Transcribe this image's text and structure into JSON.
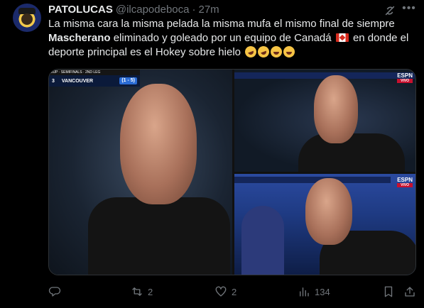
{
  "author": {
    "display_name": "PATOLUCAS",
    "handle": "@ilcapodeboca",
    "separator": "·",
    "time": "27m"
  },
  "tweet": {
    "line1": "La misma cara la misma pelada la misma mufa el mismo final de siempre",
    "bold_name": "Mascherano",
    "line2_after": " eliminado y goleado por un equipo de Canadá ",
    "line2_tail": " en donde el",
    "line3": "deporte principal es el Hokey sobre hielo "
  },
  "media": {
    "scoreboard": {
      "stage": "JUP · SEMIFINALS · 2ND LEG",
      "home_score": "3",
      "away_team": "VANCOUVER",
      "aggregate": "(1 - 5)"
    },
    "espn_logo": "ESPN",
    "espn_live": "VIVO"
  },
  "actions": {
    "replies": "",
    "retweets": "2",
    "likes": "2",
    "views": "134"
  },
  "icons": [
    "grok-icon",
    "more-icon",
    "reply-icon",
    "retweet-icon",
    "like-icon",
    "views-icon",
    "bookmark-icon",
    "share-icon"
  ],
  "colors": {
    "background": "#000000",
    "text": "#e7e9ea",
    "muted": "#71767b"
  }
}
